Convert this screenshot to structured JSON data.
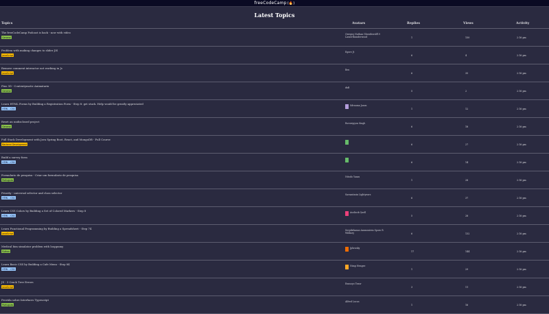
{
  "navbar": {
    "brand": "freeCodeCamp",
    "flame_icon": "(🔥)"
  },
  "heading": "Latest Topics",
  "columns": {
    "topics": "Topics",
    "avatars": "Avatars",
    "replies": "Replies",
    "views": "Views",
    "activity": "Activity"
  },
  "colors": {
    "green": "#8bc34a",
    "orange": "#ffbf00",
    "blue": "#99c9ff"
  },
  "rows": [
    {
      "title": "The freeCodeCamp Podcast is back - now with video",
      "tag": "General",
      "tag_color": "green",
      "posters": "Qweguy  Nathan  Ghentlewolf19  Lasserthunderwood",
      "avatar": "",
      "replies": "1",
      "views": "150",
      "activity": "2:16 pm"
    },
    {
      "title": "Problem with making changes to slider JIS",
      "tag": "JavaScript",
      "tag_color": "orange",
      "posters": "Egore  Jt",
      "avatar": "",
      "replies": "6",
      "views": "4",
      "activity": "2:16 pm"
    },
    {
      "title": "Remove comment interactor not working in Js",
      "tag": "JavaScript",
      "tag_color": "orange",
      "posters": "Bex",
      "avatar": "",
      "replies": "6",
      "views": "35",
      "activity": "2:16 pm"
    },
    {
      "title": "Pixo 3D - Contentymotic Animatarix",
      "tag": "General",
      "tag_color": "green",
      "posters": "dxB",
      "avatar": "",
      "replies": "5",
      "views": "2",
      "activity": "2:16 pm"
    },
    {
      "title": "Learn HTML Forms by Building a Registration Form - Step 8: get stuck. Help would be greatly appreciated",
      "tag": "HTML - CSS",
      "tag_color": "blue",
      "posters": "Sdrauma  Jason",
      "avatar": "#b39ddb",
      "replies": "1",
      "views": "12",
      "activity": "2:16 pm"
    },
    {
      "title": "Reset an undisclosed project",
      "tag": "General",
      "tag_color": "green",
      "posters": "Rororepyon  Singh",
      "avatar": "",
      "replies": "6",
      "views": "18",
      "activity": "2:16 pm"
    },
    {
      "title": "Full Stack Development with Java Spring Boot, React, and MongoDB - Full Course",
      "tag": "Backend Development",
      "tag_color": "orange",
      "posters": "",
      "avatar": "#66bb6a",
      "replies": "6",
      "views": "27",
      "activity": "2:16 pm"
    },
    {
      "title": "Build a survey form",
      "tag": "HTML - CSS",
      "tag_color": "blue",
      "posters": "",
      "avatar": "#66bb6a",
      "replies": "6",
      "views": "14",
      "activity": "2:16 pm"
    },
    {
      "title": "Formulario de pesquisa - Criar um formulario de pesquisa",
      "tag": "Portugues",
      "tag_color": "green",
      "posters": "Nitodo  Yasax",
      "avatar": "",
      "replies": "1",
      "views": "28",
      "activity": "2:16 pm"
    },
    {
      "title": "Priority - universal selector and class selector",
      "tag": "HTML - CSS",
      "tag_color": "blue",
      "posters": "Sarnastasin  Lightyears",
      "avatar": "",
      "replies": "6",
      "views": "37",
      "activity": "2:16 pm"
    },
    {
      "title": "Learn CSS Colors by Building a Set of Colored Markers - Step 8",
      "tag": "HTML - CSS",
      "tag_color": "blue",
      "posters": "Asoliock  Quell",
      "avatar": "#ec407a",
      "replies": "5",
      "views": "28",
      "activity": "2:16 pm"
    },
    {
      "title": "Learn Functional Programming by Building a Spreadsheet - Step 74",
      "tag": "JavaScript",
      "tag_color": "orange",
      "posters": "Serpilsikaxas  Ammoniven  Sporo R  Wildney",
      "avatar": "",
      "replies": "6",
      "views": "132",
      "activity": "2:16 pm"
    },
    {
      "title": "Medical bim simulator problem with looppumy",
      "tag": "Python",
      "tag_color": "green",
      "posters": "Jphrusky",
      "avatar": "#ef6c00",
      "replies": "17",
      "views": "144",
      "activity": "2:16 pm"
    },
    {
      "title": "Learn Basic CSS by Building a Cafe Menu - Step 84",
      "tag": "HTML - CSS",
      "tag_color": "blue",
      "posters": "Nimp  Hengee",
      "avatar": "#ffa726",
      "replies": "1",
      "views": "29",
      "activity": "2:16 pm"
    },
    {
      "title": "JS - 3 Crack Tree Errors",
      "tag": "JavaScript",
      "tag_color": "orange",
      "posters": "Ennsoyo  Teasr",
      "avatar": "",
      "replies": "3",
      "views": "11",
      "activity": "2:16 pm"
    },
    {
      "title": "Provida sobre Interfaces Typescript",
      "tag": "Portugues",
      "tag_color": "green",
      "posters": "Alfred  Lucas",
      "avatar": "",
      "replies": "1",
      "views": "16",
      "activity": "2:16 pm"
    }
  ]
}
